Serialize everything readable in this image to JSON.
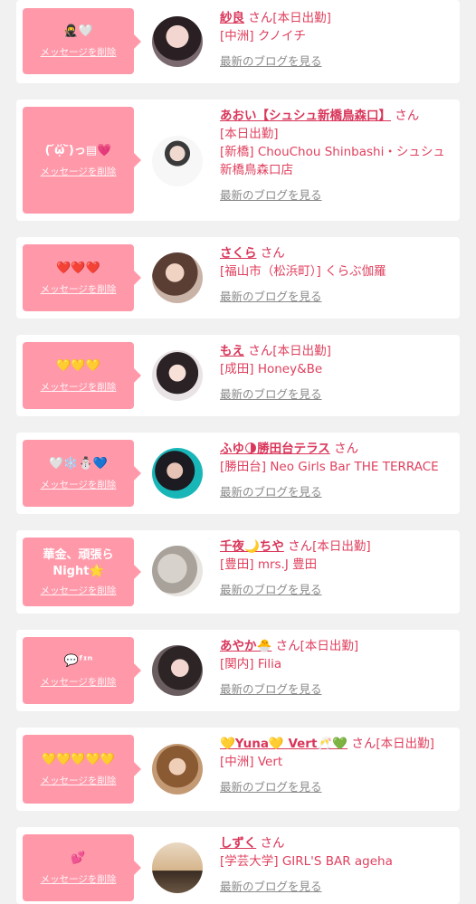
{
  "delete_label": "メッセージを削除",
  "blog_label": "最新のブログを見る",
  "san_label": "さん",
  "cards": [
    {
      "msg": "🥷🤍",
      "name": "紗良",
      "status": "[本日出勤]",
      "shop": "[中洲] クノイチ"
    },
    {
      "msg": "( ᷄ᾥ ᷅)っ▤💗",
      "name": "あおい【シュシュ新橋鳥森口】",
      "status": "[本日出勤]",
      "shop": "[新橋] ChouChou Shinbashi・シュシュ新橋鳥森口店"
    },
    {
      "msg": "❤️❤️❤️",
      "name": "さくら",
      "status": "",
      "shop": "[福山市（松浜町）] くらぶ伽羅"
    },
    {
      "msg": "💛💛💛",
      "name": "もえ",
      "status": "[本日出勤]",
      "shop": "[成田] Honey&Be"
    },
    {
      "msg": "🤍❄️⛄💙",
      "name": "ふゆ🌗勝田台テラス",
      "status": "",
      "shop": "[勝田台] Neo Girls Bar THE TERRACE"
    },
    {
      "msg": "華金、頑張ら Night🌟",
      "name": "千夜🌙ちや",
      "status": "[本日出勤]",
      "shop": "[豊田] mrs.J 豊田"
    },
    {
      "msg": "💬ᶠᶦⁿ",
      "name": "あやか🐣",
      "status": "[本日出勤]",
      "shop": "[関内] Filia"
    },
    {
      "msg": "💛💛💛💛💛",
      "name": "💛Yuna💛 Vert🥂💚",
      "status": "[本日出勤]",
      "shop": "[中洲] Vert"
    },
    {
      "msg": "💕",
      "name": "しずく",
      "status": "",
      "shop": "[学芸大学] GIRL'S BAR ageha"
    }
  ],
  "colors": {
    "accent": "#ff99aa",
    "name": "#d9365a",
    "background": "#f1f1f1"
  }
}
